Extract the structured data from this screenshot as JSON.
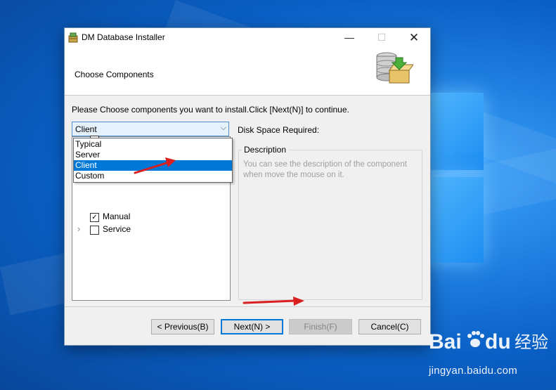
{
  "window": {
    "title": "DM Database Installer",
    "minimize_glyph": "—",
    "maximize_glyph": "☐",
    "close_glyph": "✕"
  },
  "header": {
    "title": "Choose Components",
    "icon": "database-install-icon"
  },
  "instruction": "Please Choose components you want to install.Click [Next(N)] to continue.",
  "combo": {
    "selected": "Client",
    "options": [
      "Typical",
      "Server",
      "Client",
      "Custom"
    ]
  },
  "tree": {
    "items": [
      {
        "label": "Manual",
        "checked": true
      },
      {
        "label": "Service",
        "checked": false
      }
    ]
  },
  "disk_space_label": "Disk Space Required:",
  "description": {
    "title": "Description",
    "text": "You can see the description of the component when move the mouse on it."
  },
  "buttons": {
    "previous": "< Previous(B)",
    "next": "Next(N) >",
    "finish": "Finish(F)",
    "cancel": "Cancel(C)"
  },
  "watermark": {
    "logo_text": "Bai du 经验",
    "url": "jingyan.baidu.com"
  },
  "colors": {
    "accent": "#0078d7",
    "annotation_arrow": "#d91f1f",
    "desktop": "#0a5fc4"
  }
}
